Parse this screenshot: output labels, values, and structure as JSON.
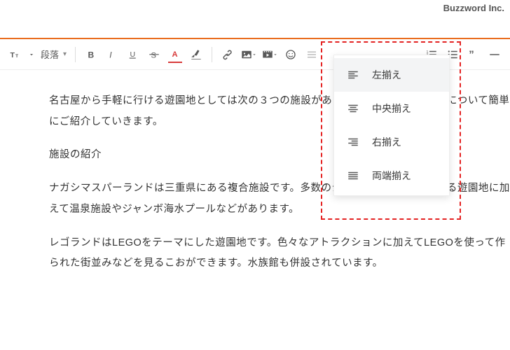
{
  "header": {
    "company": "Buzzword Inc."
  },
  "toolbar": {
    "paragraph_label": "段落"
  },
  "alignment_menu": {
    "items": [
      {
        "label": "左揃え"
      },
      {
        "label": "中央揃え"
      },
      {
        "label": "右揃え"
      },
      {
        "label": "両端揃え"
      }
    ]
  },
  "content": {
    "p1": "名古屋から手軽に行ける遊園地としては次の３つの施設があります。それぞれの施設について簡単にご紹介していきます。",
    "p2": "施設の紹介",
    "p3": "ナガシマスパーランドは三重県にある複合施設です。多数のジェットコースターがある遊園地に加えて温泉施設やジャンボ海水プールなどがあります。",
    "p4": "レゴランドはLEGOをテーマにした遊園地です。色々なアトラクションに加えてLEGOを使って作られた街並みなどを見るこおができます。水族館も併設されています。"
  }
}
